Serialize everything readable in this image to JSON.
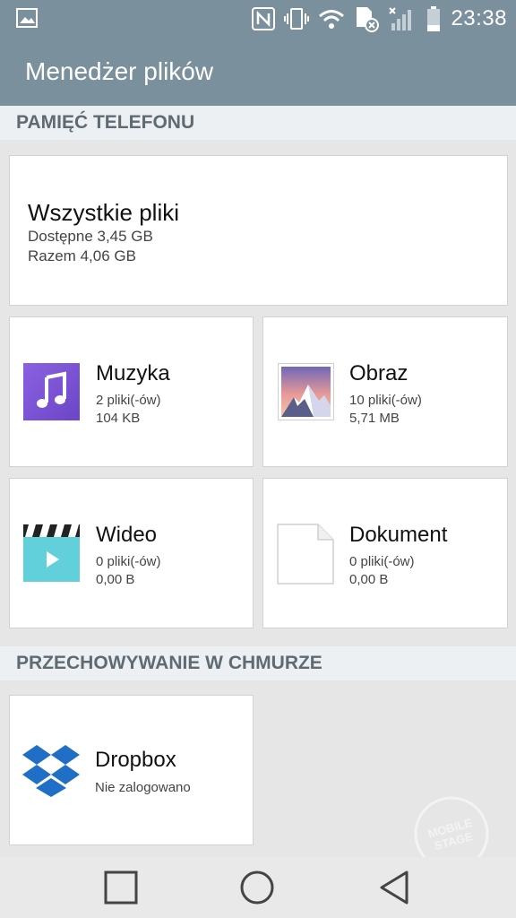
{
  "status_bar": {
    "time": "23:38",
    "icons": [
      "image-notification-icon",
      "nfc-icon",
      "vibrate-icon",
      "wifi-icon",
      "sim-icon",
      "signal-icon",
      "battery-icon"
    ]
  },
  "app_bar": {
    "title": "Menedżer plików"
  },
  "sections": {
    "phone": {
      "title": "PAMIĘĆ TELEFONU"
    },
    "cloud": {
      "title": "PRZECHOWYWANIE W CHMURZE"
    }
  },
  "all_files": {
    "title": "Wszystkie pliki",
    "available": "Dostępne 3,45 GB",
    "total": "Razem 4,06 GB"
  },
  "categories": [
    {
      "name": "Muzyka",
      "count": "2 pliki(-ów)",
      "size": "104 KB",
      "icon": "music-icon"
    },
    {
      "name": "Obraz",
      "count": "10 pliki(-ów)",
      "size": "5,71 MB",
      "icon": "image-icon"
    },
    {
      "name": "Wideo",
      "count": "0 pliki(-ów)",
      "size": "0,00 B",
      "icon": "video-icon"
    },
    {
      "name": "Dokument",
      "count": "0 pliki(-ów)",
      "size": "0,00 B",
      "icon": "document-icon"
    }
  ],
  "cloud_services": [
    {
      "name": "Dropbox",
      "status": "Nie zalogowano",
      "icon": "dropbox-icon"
    }
  ],
  "watermark": {
    "text": "MOBILE STAGE"
  },
  "colors": {
    "bar": "#7a909c",
    "music": "#7d55d6",
    "video": "#62d0db",
    "dropbox": "#1f6fc6"
  }
}
